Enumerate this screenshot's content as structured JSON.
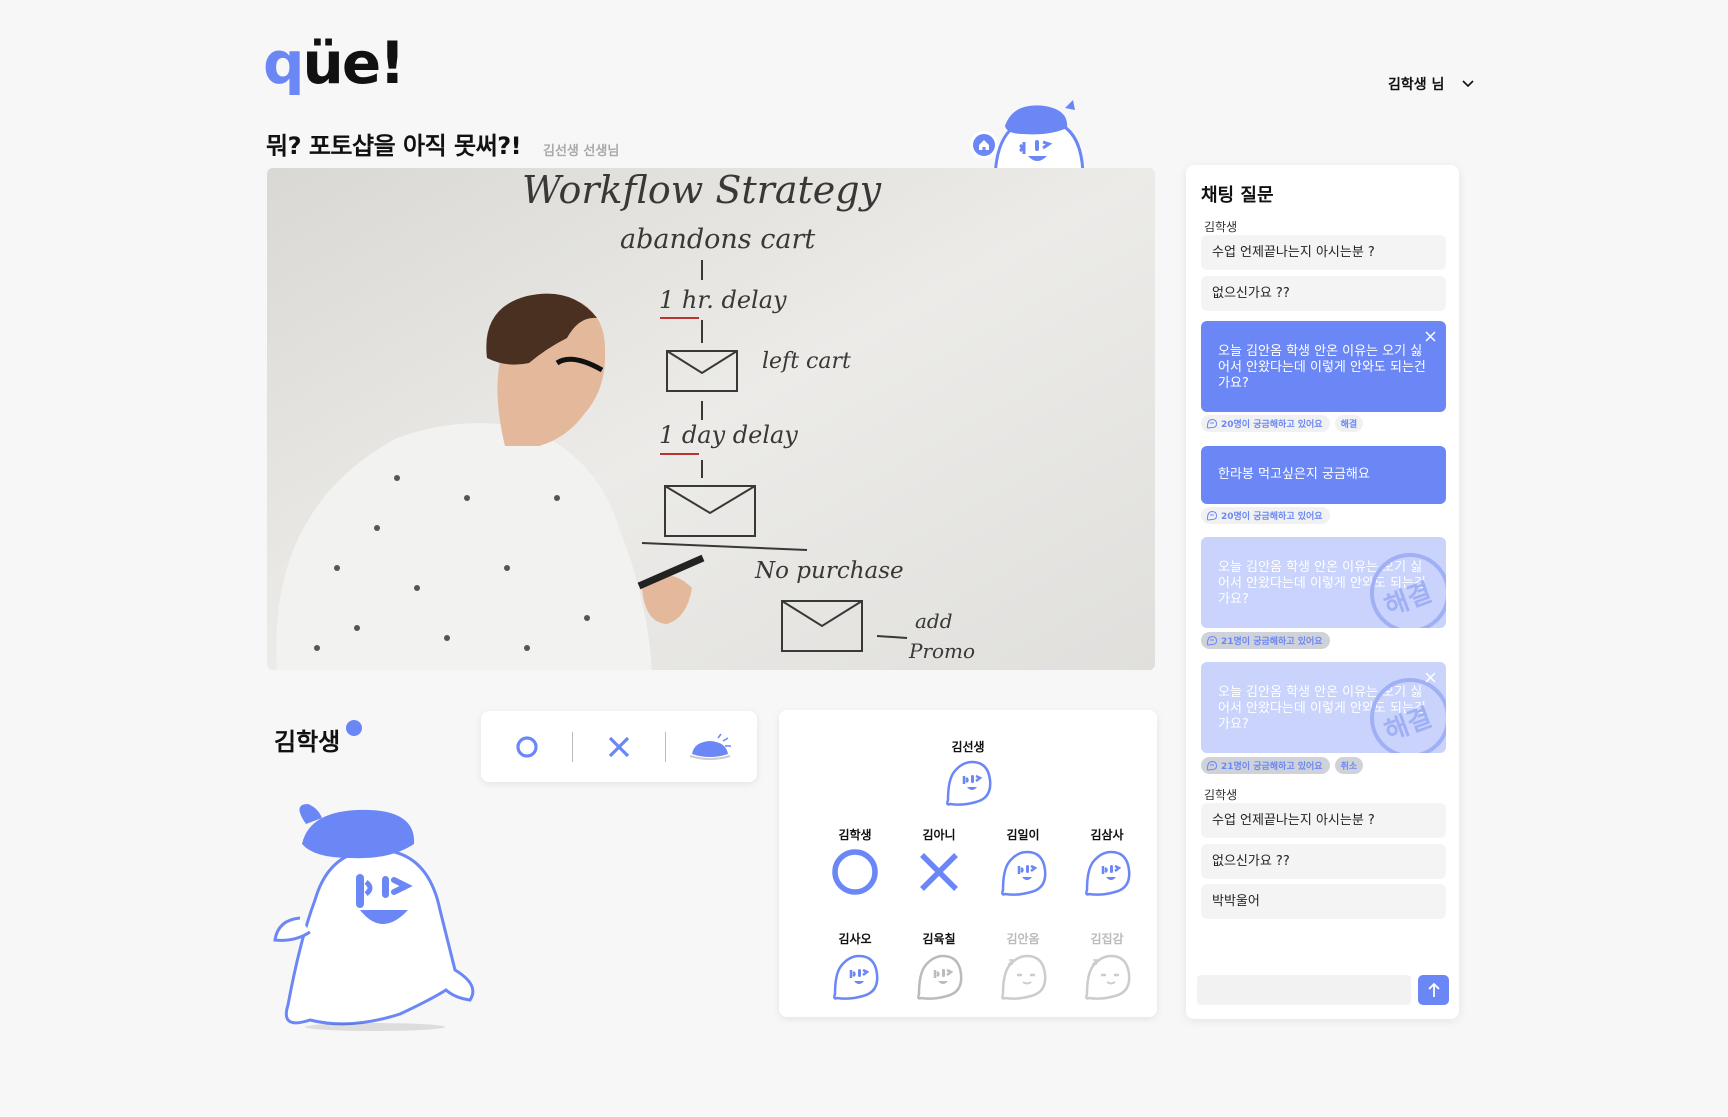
{
  "brand": {
    "logo_q": "q",
    "logo_rest": "üe!",
    "accent": "#6b87f6"
  },
  "header": {
    "user_label": "김학생 님"
  },
  "lecture": {
    "title": "뭐? 포토샵을 아직 못써?!",
    "teacher": "김선생 선생님"
  },
  "video": {
    "whiteboard": [
      "Workflow Strategy",
      "abandons cart",
      "1 hr. delay",
      "left cart",
      "1 day delay",
      "No purchase",
      "add",
      "Promo"
    ]
  },
  "student": {
    "name": "김학생"
  },
  "reactions": [
    {
      "name": "reaction-o",
      "icon": "circle-icon"
    },
    {
      "name": "reaction-x",
      "icon": "cross-icon"
    },
    {
      "name": "reaction-sleep",
      "icon": "beret-icon"
    }
  ],
  "attendance": {
    "teacher": {
      "name": "김선생",
      "state": "face"
    },
    "students": [
      {
        "name": "김학생",
        "state": "o"
      },
      {
        "name": "김아니",
        "state": "x"
      },
      {
        "name": "김일이",
        "state": "face"
      },
      {
        "name": "김삼사",
        "state": "face"
      },
      {
        "name": "김사오",
        "state": "face"
      },
      {
        "name": "김육칠",
        "state": "face-gray"
      },
      {
        "name": "김안옴",
        "state": "sleep"
      },
      {
        "name": "김집감",
        "state": "sleep"
      }
    ]
  },
  "chat": {
    "title": "채팅 질문",
    "group1": {
      "sender": "김학생",
      "messages": [
        "수업 언제끝나는지 아시는분 ?",
        "없으신가요 ??"
      ]
    },
    "questions": [
      {
        "text": "오늘 김안옴 학생 안온 이유는 오기 싫어서 안왔다는데 이렇게 안와도 되는건가요?",
        "curious": "20명이 궁금해하고 있어요",
        "action": "해결",
        "resolved": false
      },
      {
        "text": "한라봉 먹고싶은지 궁금해요",
        "curious": "20명이 궁금해하고 있어요",
        "action": "",
        "resolved": false
      },
      {
        "text": "오늘 김안옴 학생 안온 이유는 오기 싫어서 안왔다는데 이렇게 안와도 되는건가요?",
        "curious": "21명이 궁금해하고 있어요",
        "action": "",
        "resolved": true
      },
      {
        "text": "오늘 김안옴 학생 안온 이유는 오기 싫어서 안왔다는데 이렇게 안와도 되는건가요?",
        "curious": "21명이 궁금해하고 있어요",
        "action": "취소",
        "resolved": true
      }
    ],
    "stamp_text": "해결",
    "group2": {
      "sender": "김학생",
      "messages": [
        "수업 언제끝나는지 아시는분 ?",
        "없으신가요 ??",
        "박박울어"
      ]
    },
    "input_placeholder": ""
  }
}
